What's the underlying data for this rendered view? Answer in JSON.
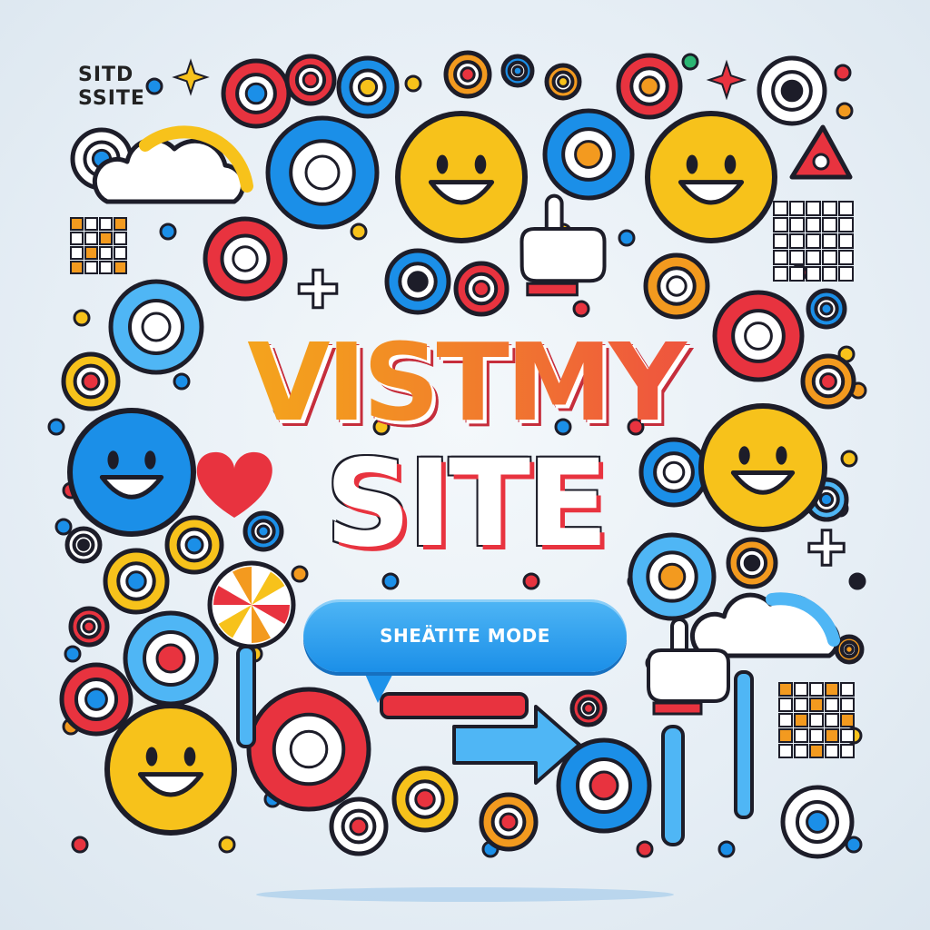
{
  "corner_label": {
    "line1": "SITD",
    "line2": "SSITE"
  },
  "headline": {
    "line1": "VISTMY",
    "line2": "SITE"
  },
  "cta_button": {
    "label": "SHEÄTITE MODE"
  },
  "colors": {
    "background": "#e6eef5",
    "outline": "#1d1d29",
    "red": "#e8333f",
    "orange": "#f39a1f",
    "yellow": "#f7c21b",
    "blue": "#1b8fe8",
    "light_blue": "#4fb6f5",
    "white": "#ffffff"
  },
  "icons": [
    "smiley-face-icon",
    "ring-icon",
    "sparkle-icon",
    "cloud-icon",
    "pointing-hand-icon",
    "heart-icon",
    "grid-icon",
    "arrow-right-icon",
    "beach-ball-icon",
    "triangle-icon"
  ]
}
